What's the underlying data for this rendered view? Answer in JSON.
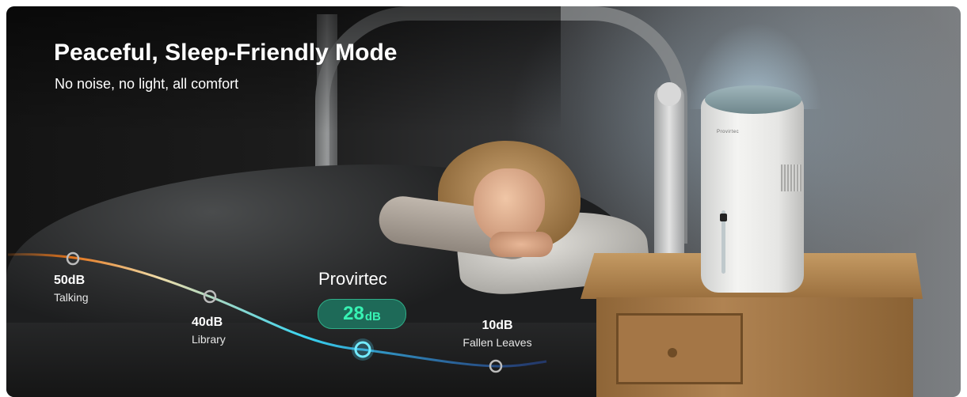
{
  "banner": {
    "title": "Peaceful, Sleep-Friendly Mode",
    "subtitle": "No noise, no light, all comfort"
  },
  "noise_scale": {
    "levels": [
      {
        "value": "50dB",
        "caption": "Talking"
      },
      {
        "value": "40dB",
        "caption": "Library"
      },
      {
        "value": "10dB",
        "caption": "Fallen Leaves"
      }
    ],
    "highlight": {
      "brand": "Provirtec",
      "value_number": "28",
      "value_unit": "dB"
    }
  },
  "product": {
    "brand_print": "Provirtec"
  },
  "colors": {
    "curve_start": "#e3741c",
    "curve_mid": "#f0dca8",
    "curve_cyan": "#39d4f0",
    "curve_end": "#2e5fd8",
    "badge_bg": "#1e6a58",
    "badge_text": "#37f2b3"
  }
}
